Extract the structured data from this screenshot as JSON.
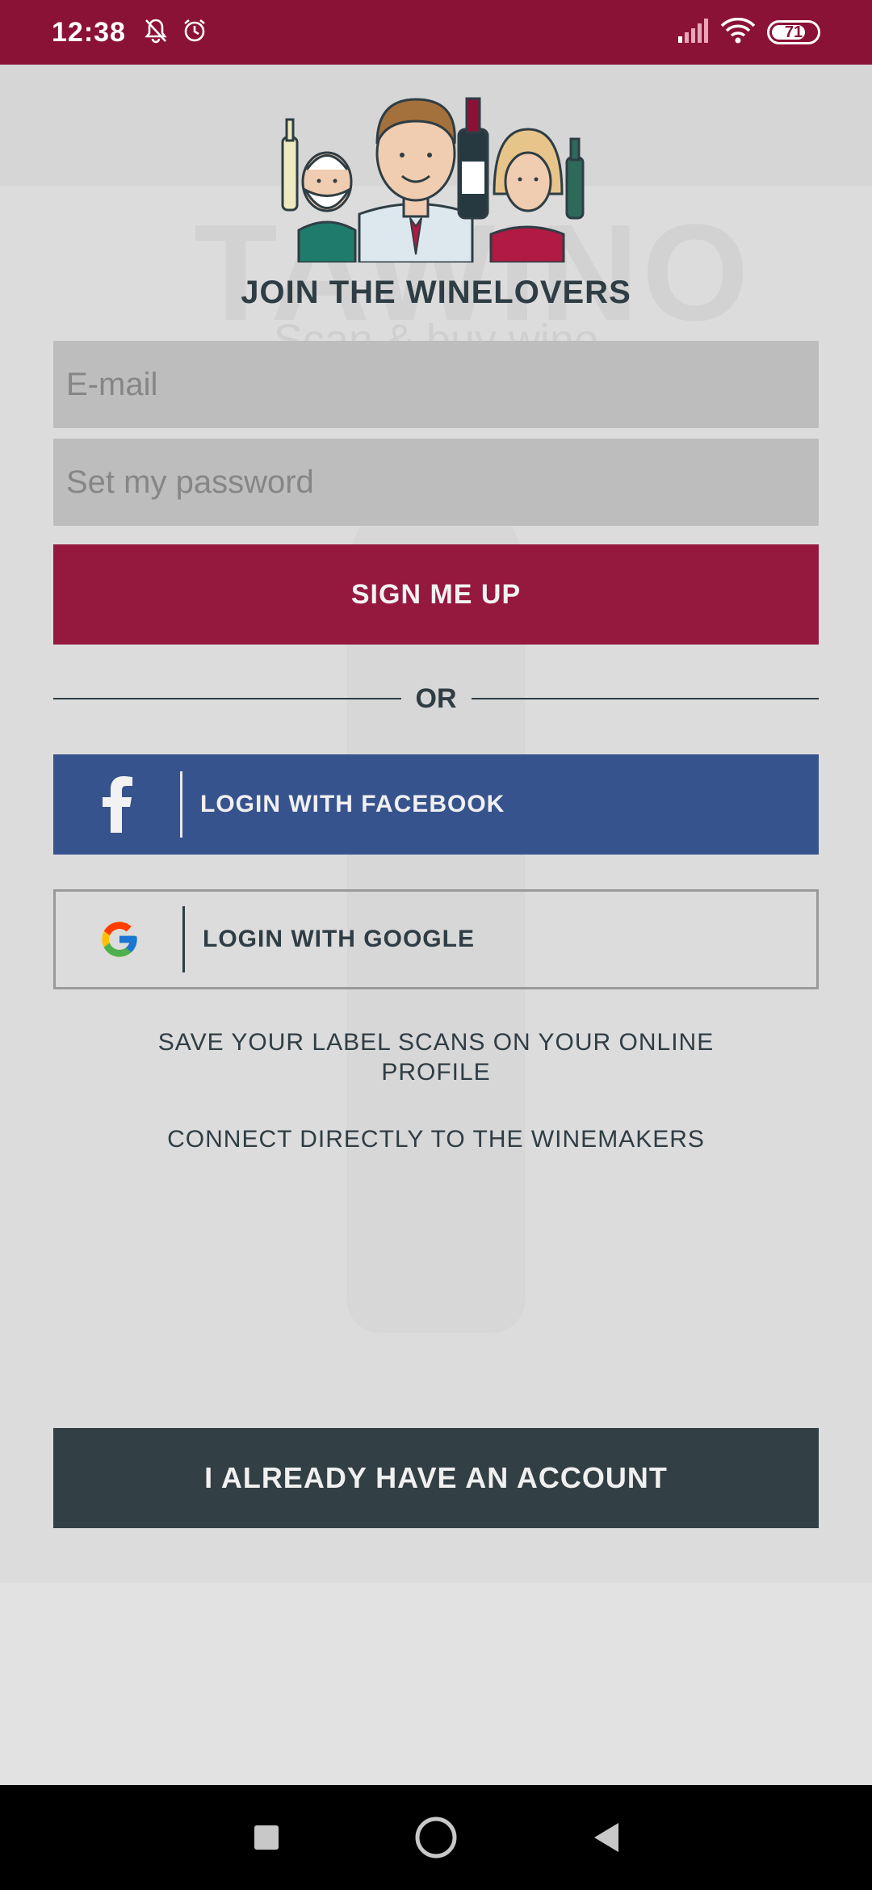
{
  "status_bar": {
    "time": "12:38",
    "battery": "71",
    "icons": [
      "bell-muted-icon",
      "alarm-icon",
      "signal-icon",
      "wifi-icon",
      "battery-icon"
    ]
  },
  "background": {
    "logo": "TAWINO",
    "tagline": "Scan & buy wine"
  },
  "title": "JOIN THE WINELOVERS",
  "form": {
    "email_placeholder": "E-mail",
    "password_placeholder": "Set my password",
    "signup_label": "SIGN ME UP"
  },
  "or_label": "OR",
  "social": {
    "facebook_label": "LOGIN WITH FACEBOOK",
    "google_label": "LOGIN WITH GOOGLE"
  },
  "benefits": [
    "SAVE YOUR LABEL SCANS ON YOUR ONLINE PROFILE",
    "CONNECT DIRECTLY TO THE WINEMAKERS"
  ],
  "account_label": "I ALREADY HAVE AN ACCOUNT",
  "colors": {
    "brand": "#95183f",
    "status_bar": "#8b1237",
    "facebook": "#37538d",
    "dark": "#323f45"
  }
}
